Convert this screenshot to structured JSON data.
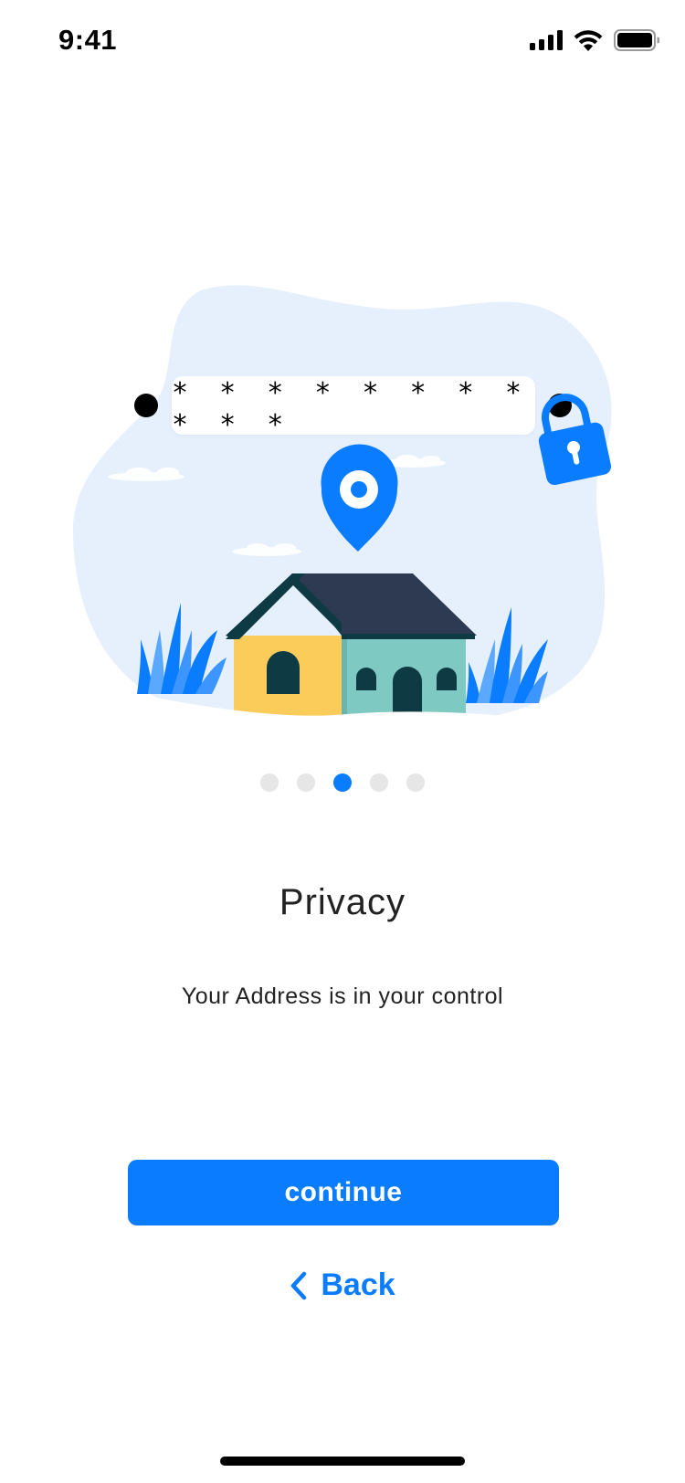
{
  "status_bar": {
    "time": "9:41"
  },
  "illustration": {
    "password_mask": "* * * * * * * * * * *"
  },
  "pager": {
    "total": 5,
    "active_index": 2
  },
  "content": {
    "title": "Privacy",
    "subtitle": "Your Address is in your control"
  },
  "actions": {
    "continue_label": "continue",
    "back_label": "Back"
  },
  "colors": {
    "accent": "#0a7cff",
    "blob": "#e6f0fd",
    "dot_inactive": "#e6e6e6",
    "text": "#222222"
  },
  "icons": {
    "signal": "signal-icon",
    "wifi": "wifi-icon",
    "battery": "battery-icon",
    "lock": "lock-icon",
    "location_pin": "location-pin-icon",
    "house": "house-icon",
    "back_chevron": "chevron-left-icon"
  }
}
